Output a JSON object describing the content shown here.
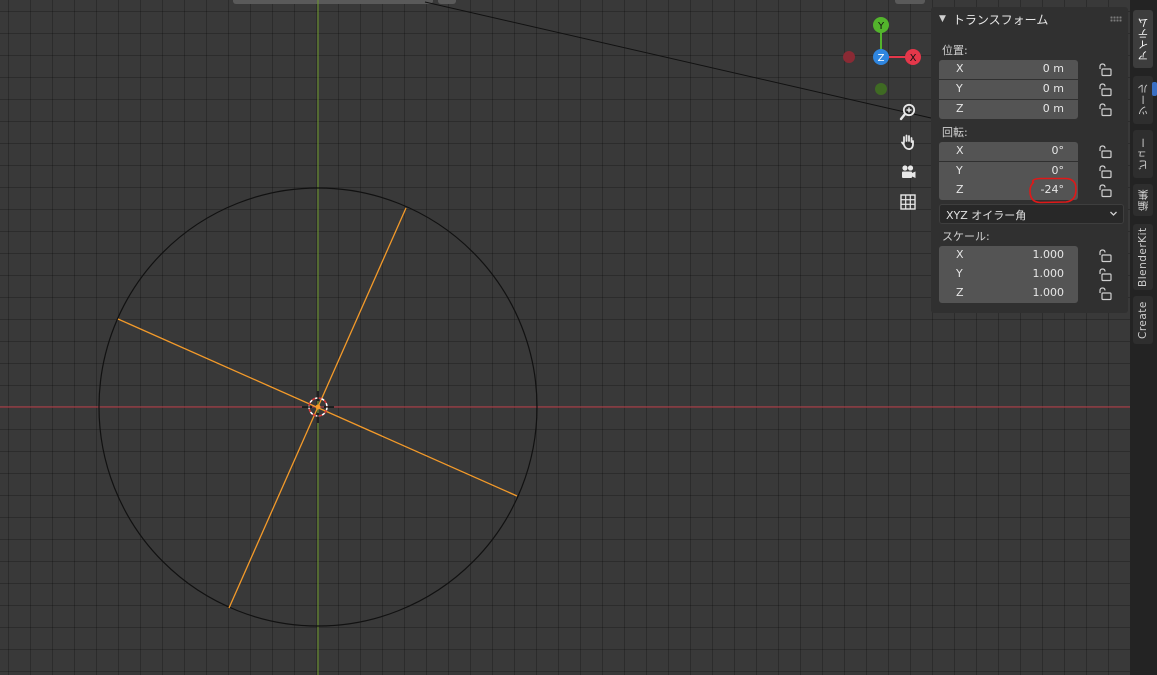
{
  "gizmo": {
    "axis_y": "Y",
    "axis_z": "Z",
    "axis_x": "X",
    "colors": {
      "x": "#e4374a",
      "y": "#53b42c",
      "z": "#2f86e0",
      "x_neg": "#8a2a34",
      "y_neg": "#3f6a23"
    }
  },
  "nav_icons": [
    "zoom-icon",
    "pan-hand-icon",
    "camera-icon",
    "grid-icon"
  ],
  "transform_panel": {
    "title": "トランスフォーム",
    "location": {
      "label": "位置:",
      "rows": [
        {
          "axis": "X",
          "value": "0 m"
        },
        {
          "axis": "Y",
          "value": "0 m"
        },
        {
          "axis": "Z",
          "value": "0 m"
        }
      ]
    },
    "rotation": {
      "label": "回転:",
      "rows": [
        {
          "axis": "X",
          "value": "0°"
        },
        {
          "axis": "Y",
          "value": "0°"
        },
        {
          "axis": "Z",
          "value": "-24°"
        }
      ],
      "mode": "XYZ オイラー角"
    },
    "scale": {
      "label": "スケール:",
      "rows": [
        {
          "axis": "X",
          "value": "1.000"
        },
        {
          "axis": "Y",
          "value": "1.000"
        },
        {
          "axis": "Z",
          "value": "1.000"
        }
      ]
    }
  },
  "sidebar_tabs": [
    {
      "label": "アイテム",
      "active": true
    },
    {
      "label": "ツール",
      "active": false
    },
    {
      "label": "ビュー",
      "active": false
    },
    {
      "label": "編集",
      "active": false
    },
    {
      "label": "BlenderKit",
      "active": false
    },
    {
      "label": "Create",
      "active": false
    }
  ],
  "colors": {
    "viewport_bg": "#393939",
    "x_axis_line": "#c8454f",
    "y_axis_line": "#6f9a2c",
    "selection_orange": "#f39a2a",
    "highlight_annotation": "#e01818"
  }
}
